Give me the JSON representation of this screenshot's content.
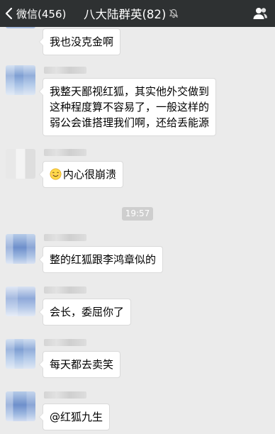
{
  "navbar": {
    "back_label": "微信(456)",
    "title": "八大陆群英(82)",
    "icons": {
      "back": "chevron-left-icon",
      "mute": "bell-muted-icon",
      "contacts": "group-members-icon"
    },
    "colors": {
      "background": "#2e3132",
      "text": "#ffffff"
    }
  },
  "chat": {
    "background": "#ebebeb",
    "time_divider": "19:57",
    "messages": [
      {
        "text_lines": [
          "我也没克金啊"
        ]
      },
      {
        "text_lines": [
          "我整天鄙视红狐，其实他外交做到",
          "这种程度算不容易了，一般这样的",
          "弱公会谁搭理我们啊，还给丢能源"
        ]
      },
      {
        "emoji": "smiling-face-icon",
        "text_lines": [
          "内心很崩溃"
        ]
      },
      {
        "text_lines": [
          "整的红狐跟李鸿章似的"
        ]
      },
      {
        "text_lines": [
          "会长，委屈你了"
        ]
      },
      {
        "text_lines": [
          "每天都去卖笑"
        ]
      },
      {
        "text_lines": [
          "@红狐九生"
        ]
      }
    ]
  }
}
